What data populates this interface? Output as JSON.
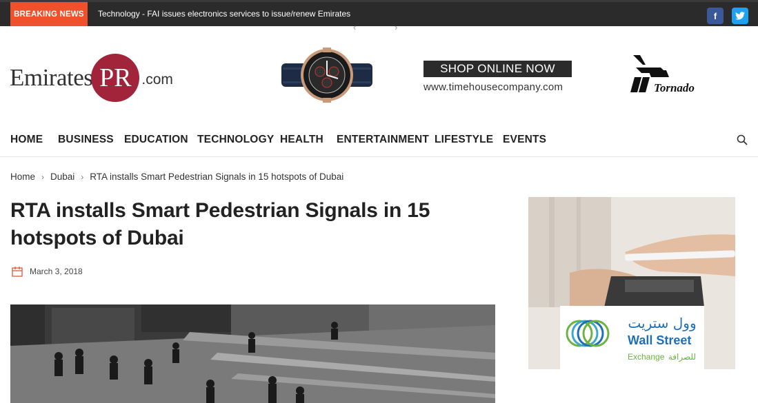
{
  "topbar": {
    "breaking_label": "BREAKING NEWS",
    "ticker_text": "Technology - FAI issues electronics services to issue/renew Emirates",
    "arrows": "‹ ›",
    "facebook_glyph": "f",
    "twitter_glyph": "t"
  },
  "header": {
    "logo_left": "Emirates",
    "logo_mid": "PR",
    "logo_right": ".com",
    "ad_shop_label": "SHOP ONLINE NOW",
    "ad_shop_url": "www.timehousecompany.com",
    "ad_brand": "Tornado"
  },
  "nav": {
    "items": [
      "HOME",
      "BUSINESS",
      "EDUCATION",
      "TECHNOLOGY",
      "HEALTH",
      "ENTERTAINMENT",
      "LIFESTYLE",
      "EVENTS"
    ]
  },
  "breadcrumb": {
    "home": "Home",
    "sep": "›",
    "category": "Dubai",
    "current": "RTA installs Smart Pedestrian Signals in 15 hotspots of Dubai"
  },
  "article": {
    "title": "RTA installs Smart Pedestrian Signals in 15 hotspots of Dubai",
    "date": "March 3, 2018"
  },
  "sidebar_ad": {
    "brand_arabic": "وول ستريت",
    "brand_english": "Wall Street",
    "sub_english": "Exchange",
    "sub_arabic": "للصرافة"
  },
  "colors": {
    "breaking": "#f0502a",
    "logo_circle": "#a1243a",
    "facebook": "#3b5998",
    "twitter": "#1da1f2",
    "wallstreet_blue": "#1e6fb5",
    "wallstreet_green": "#6cb33f"
  }
}
